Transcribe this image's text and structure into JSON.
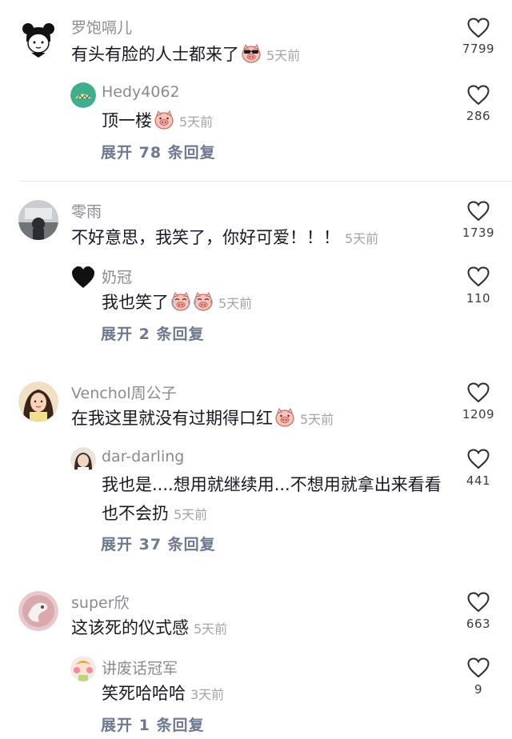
{
  "time_label": "5天前",
  "threads": [
    {
      "user": "罗饱嗝儿",
      "text": "有头有脸的人士都来了",
      "time": "5天前",
      "likes": "7799",
      "reply": {
        "user": "Hedy4062",
        "text": "顶一楼",
        "time": "5天前",
        "likes": "286"
      },
      "expand": "展开 78 条回复"
    },
    {
      "user": "零雨",
      "text": "不好意思，我笑了，你好可爱！！！",
      "time": "5天前",
      "likes": "1739",
      "reply": {
        "user": "奶冠",
        "text": "我也笑了",
        "time": "5天前",
        "likes": "110"
      },
      "expand": "展开 2 条回复"
    },
    {
      "user": "Venchol周公子",
      "text": "在我这里就没有过期得口红",
      "time": "5天前",
      "likes": "1209",
      "reply": {
        "user": "dar-darling",
        "text": "我也是....想用就继续用...不想用就拿出来看看也不会扔",
        "time": "5天前",
        "likes": "441"
      },
      "expand": "展开 37 条回复"
    },
    {
      "user": "super欣",
      "text": "这该死的仪式感",
      "time": "5天前",
      "likes": "663",
      "reply": {
        "user": "讲废话冠军",
        "text": "笑死哈哈哈",
        "time": "3天前",
        "likes": "9"
      },
      "expand": "展开 1 条回复"
    }
  ],
  "colors": {
    "username": "#8a8b91",
    "text": "#161823",
    "time": "#a3a4a8",
    "expand": "#6d7891",
    "divider": "#e6e6e8"
  },
  "icons": [
    "heart-outline-icon",
    "pig-emoji-icon",
    "cool-pig-emoji-icon",
    "crying-laugh-emoji-icon"
  ]
}
